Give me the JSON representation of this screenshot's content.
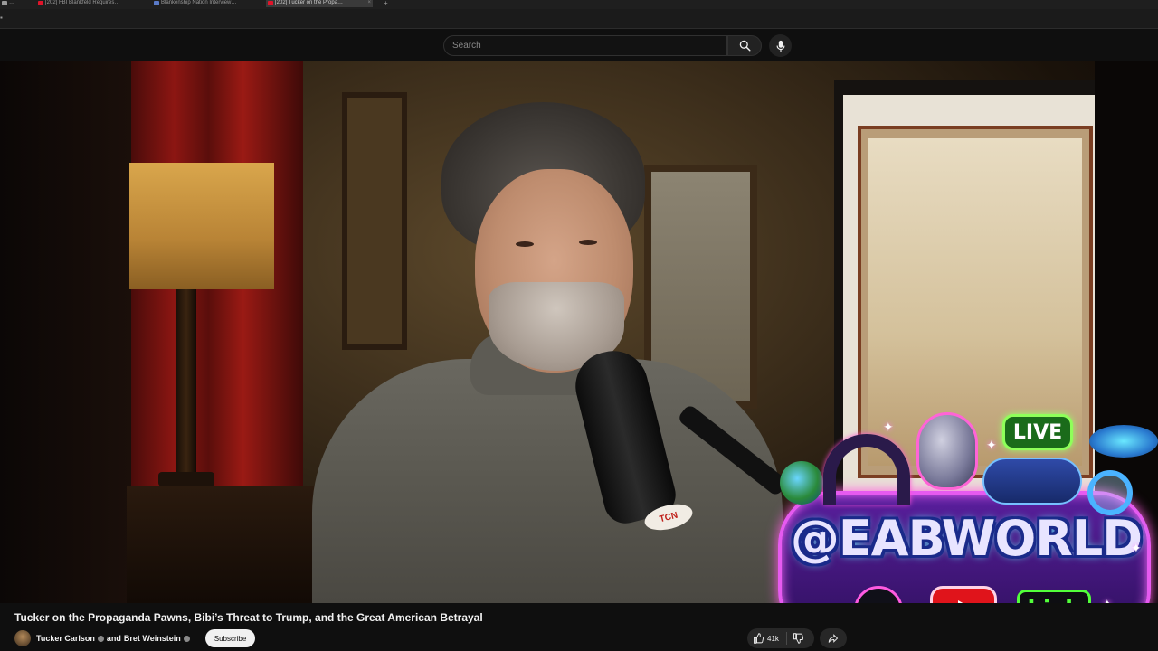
{
  "browser": {
    "tabs": [
      {
        "label": "…",
        "fav": "#9a9a9a"
      },
      {
        "label": "[202] FBI Blankfeld Requires…",
        "fav": "#e0142a"
      },
      {
        "label": "Blankenship Nation Interview…",
        "fav": "#5a7ac8"
      },
      {
        "label": "[202] Tucker on the Propa…",
        "fav": "#e0142a"
      }
    ],
    "new_tab": "+"
  },
  "header": {
    "search_placeholder": "Search"
  },
  "video": {
    "mic_badge": "TCN"
  },
  "overlay": {
    "live": "LIVE",
    "handle": "@EABWORLD",
    "tiktok": "♪",
    "kick": "kick"
  },
  "meta": {
    "title": "Tucker on the Propaganda Pawns, Bibi’s Threat to Trump, and the Great American Betrayal",
    "channel_1": "Tucker Carlson",
    "and_text": "and",
    "channel_2": "Bret Weinstein",
    "subscribe": "Subscribe",
    "like_count": "41k"
  }
}
